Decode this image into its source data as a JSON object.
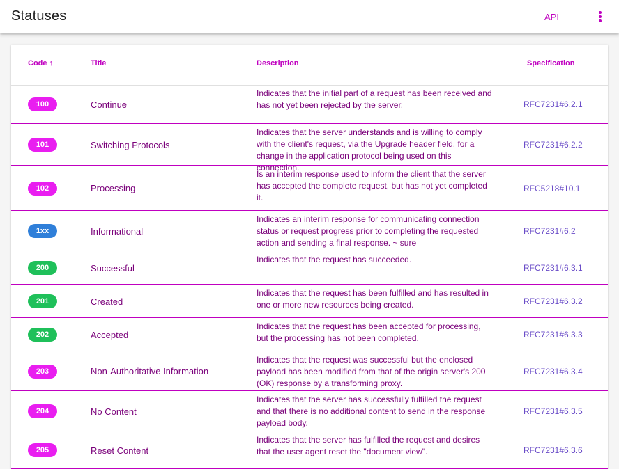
{
  "app": {
    "title": "Statuses",
    "api_label": "API"
  },
  "table": {
    "headers": {
      "code": "Code",
      "title": "Title",
      "description": "Description",
      "specification": "Specification"
    },
    "rows": [
      {
        "code": "100",
        "title": "Continue",
        "description": "Indicates that the initial part of a request has been received and has not yet been rejected by the server.",
        "spec": "RFC7231#6.2.1",
        "color": "#e91ef0"
      },
      {
        "code": "101",
        "title": "Switching Protocols",
        "description": "Indicates that the server understands and is willing to comply with the client's request, via the Upgrade header field, for a change in the application protocol being used on this connection.",
        "spec": "RFC7231#6.2.2",
        "color": "#e91ef0"
      },
      {
        "code": "102",
        "title": "Processing",
        "description": "Is an interim response used to inform the client that the server has accepted the complete request, but has not yet completed it.",
        "spec": "RFC5218#10.1",
        "color": "#e91ef0"
      },
      {
        "code": "1xx",
        "title": "Informational",
        "description": "Indicates an interim response for communicating connection status or request progress prior to completing the requested action and sending a final response. ~ sure",
        "spec": "RFC7231#6.2",
        "color": "#2f7fd9"
      },
      {
        "code": "200",
        "title": "Successful",
        "description": "Indicates that the request has succeeded.",
        "spec": "RFC7231#6.3.1",
        "color": "#1fc05a"
      },
      {
        "code": "201",
        "title": "Created",
        "description": "Indicates that the request has been fulfilled and has resulted in one or more new resources being created.",
        "spec": "RFC7231#6.3.2",
        "color": "#1fc05a"
      },
      {
        "code": "202",
        "title": "Accepted",
        "description": "Indicates that the request has been accepted for processing, but the processing has not been completed.",
        "spec": "RFC7231#6.3.3",
        "color": "#1fc05a"
      },
      {
        "code": "203",
        "title": "Non-Authoritative Information",
        "description": "Indicates that the request was successful but the enclosed payload has been modified from that of the origin server's 200 (OK) response by a transforming proxy.",
        "spec": "RFC7231#6.3.4",
        "color": "#e91ef0"
      },
      {
        "code": "204",
        "title": "No Content",
        "description": "Indicates that the server has successfully fulfilled the request and that there is no additional content to send in the response payload body.",
        "spec": "RFC7231#6.3.5",
        "color": "#e91ef0"
      },
      {
        "code": "205",
        "title": "Reset Content",
        "description": "Indicates that the server has fulfilled the request and desires that the user agent reset the \"document view\".",
        "spec": "RFC7231#6.3.6",
        "color": "#e91ef0"
      }
    ]
  }
}
